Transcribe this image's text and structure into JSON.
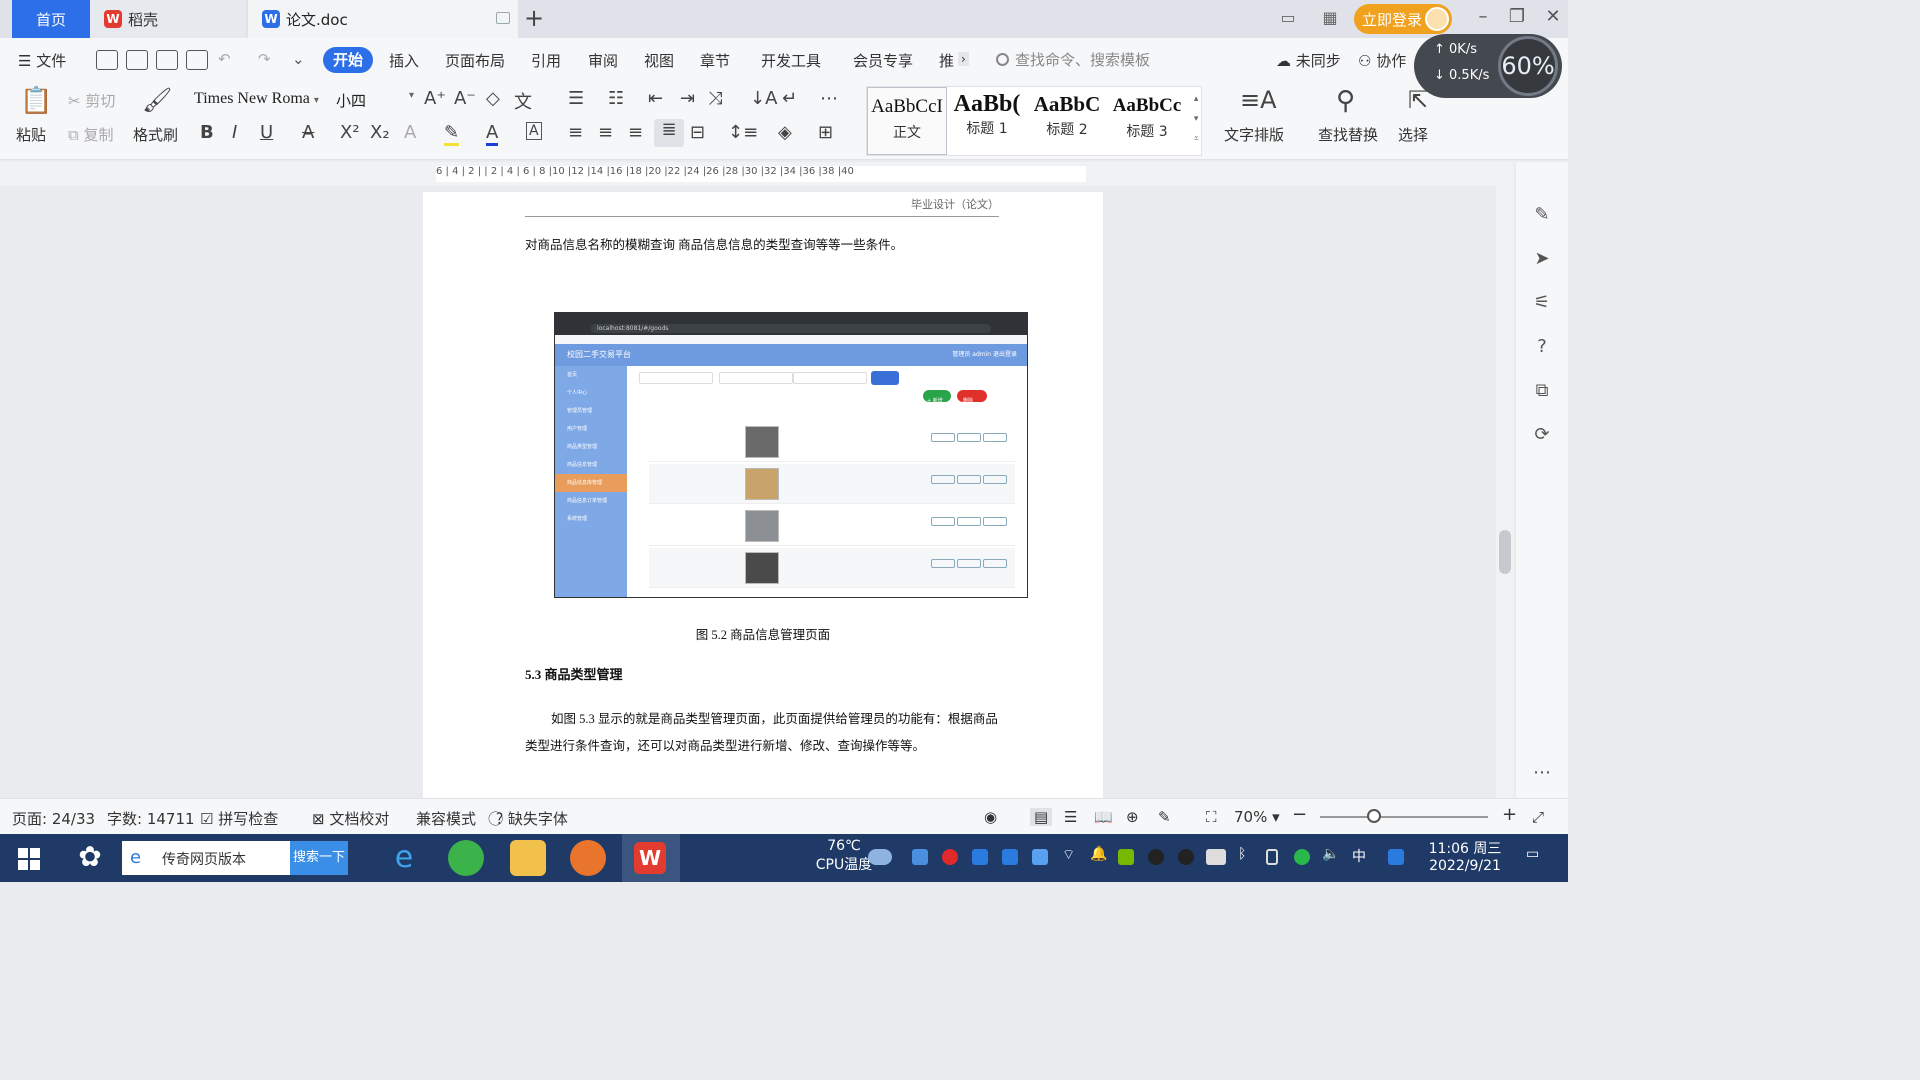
{
  "tabs": {
    "home": "首页",
    "daoke": "稻壳",
    "doc": "论文.doc"
  },
  "titlebar": {
    "login": "立即登录",
    "net_up": "0K/s",
    "net_down": "0.5K/s",
    "cpu_percent": "60%"
  },
  "menu": {
    "file": "文件",
    "items": [
      "开始",
      "插入",
      "页面布局",
      "引用",
      "审阅",
      "视图",
      "章节",
      "开发工具",
      "会员专享",
      "推"
    ],
    "search_placeholder": "查找命令、搜索模板",
    "sync": "未同步",
    "collab": "协作"
  },
  "ribbon": {
    "paste": "粘贴",
    "cut": "剪切",
    "copy": "复制",
    "format_painter": "格式刷",
    "font_name": "Times New Roma",
    "font_size": "小四",
    "styles": [
      {
        "sample": "AaBbCcI",
        "name": "正文"
      },
      {
        "sample": "AaBb(",
        "name": "标题 1"
      },
      {
        "sample": "AaBbC",
        "name": "标题 2"
      },
      {
        "sample": "AaBbCc",
        "name": "标题 3"
      }
    ],
    "text_layout": "文字排版",
    "find_replace": "查找替换",
    "select": "选择"
  },
  "ruler": {
    "ticks": "6 | 4 | 2 |   | 2 | 4 | 6 | 8 |10 |12 |14 |16 |18 |20 |22 |24 |26 |28 |30 |32 |34 |36 |38 |40"
  },
  "document": {
    "header": "毕业设计（论文）",
    "para1": "对商品信息名称的模糊查询 商品信息信息的类型查询等等一些条件。",
    "figure": {
      "url": "localhost:8081/#/goods",
      "title": "校园二手交易平台",
      "user": "管理员 admin   退出登录",
      "menu": [
        "首页",
        "个人中心",
        "管理员管理",
        "用户管理",
        "商品类型管理",
        "商品信息管理",
        "商品信息库管理",
        "商品信息订单管理",
        "系统管理"
      ],
      "add": "+ 新增",
      "del": "删除"
    },
    "caption": "图 5.2  商品信息管理页面",
    "heading": "5.3 商品类型管理",
    "para2": "如图 5.3 显示的就是商品类型管理页面，此页面提供给管理员的功能有：根据商品类型进行条件查询，还可以对商品类型进行新增、修改、查询操作等等。"
  },
  "status": {
    "page": "页面: 24/33",
    "words": "字数: 14711",
    "spell": "拼写检查",
    "proof": "文档校对",
    "compat": "兼容模式",
    "missing_font": "缺失字体",
    "zoom": "70%"
  },
  "taskbar": {
    "search_text": "传奇网页版本",
    "search_btn": "搜索一下",
    "temp": "76℃",
    "temp_label": "CPU温度",
    "ime": "中",
    "time": "11:06 周三",
    "date": "2022/9/21"
  }
}
